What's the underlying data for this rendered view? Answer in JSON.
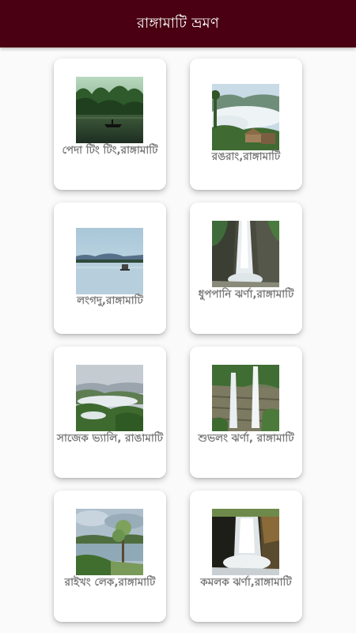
{
  "appbar": {
    "title": "রাঙ্গামাটি ভ্রমণ",
    "color": "#4a0012"
  },
  "places": [
    {
      "label": "পেদা টিং টিং,রাঙ্গামাটি",
      "image": "lake-boat-forest-photo"
    },
    {
      "label": "রঙরাং,রাঙ্গামাটি",
      "image": "hill-clouds-hut-photo"
    },
    {
      "label": "লংগদু,রাঙ্গামাটি",
      "image": "calm-lake-horizon-photo"
    },
    {
      "label": "ধুপপানি ঝর্ণা,রাঙ্গামাটি",
      "image": "waterfall-cliff-photo"
    },
    {
      "label": "সাজেক ভ্যালি, রাঙামাটি",
      "image": "valley-fog-hills-photo"
    },
    {
      "label": "শুভলং ঝর্ণা, রাঙ্গামাটি",
      "image": "rock-waterfall-photo"
    },
    {
      "label": "রাইখং লেক,রাঙ্গামাটি",
      "image": "lake-tree-sky-photo"
    },
    {
      "label": "কমলক ঝর্ণা,রাঙ্গামাটি",
      "image": "gorge-waterfall-photo"
    }
  ]
}
